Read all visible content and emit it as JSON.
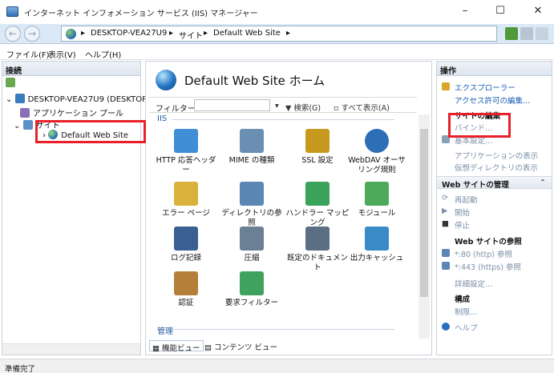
{
  "window": {
    "title": "インターネット インフォメーション サービス (IIS) マネージャー",
    "minimize": "–",
    "maximize": "☐",
    "close": "✕"
  },
  "address": {
    "crumbs": [
      "DESKTOP-VEA27U9",
      "サイト",
      "Default Web Site"
    ],
    "separator": "▸"
  },
  "menu": {
    "items": [
      "ファイル(F)",
      "表示(V)",
      "ヘルプ(H)"
    ]
  },
  "connections": {
    "header": "接続",
    "server": "DESKTOP-VEA27U9 (DESKTOP",
    "app_pools": "アプリケーション プール",
    "sites": "サイト",
    "site": "Default Web Site"
  },
  "center": {
    "title": "Default Web Site ホーム",
    "filter_label": "フィルター:",
    "search": "検索(G)",
    "show_all": "すべて表示(A)",
    "group_iis": "IIS",
    "group_manage": "管理",
    "features": [
      {
        "label": "HTTP 応答ヘッダー",
        "color": "#3f8ed6"
      },
      {
        "label": "MIME の種類",
        "color": "#6a8fb3"
      },
      {
        "label": "SSL 設定",
        "color": "#c79a1f"
      },
      {
        "label": "WebDAV オーサリング規則",
        "color": "#2c6fb6"
      },
      {
        "label": "エラー ページ",
        "color": "#d8b23a"
      },
      {
        "label": "ディレクトリの参照",
        "color": "#5b87b5"
      },
      {
        "label": "ハンドラー マッピング",
        "color": "#3aa35a"
      },
      {
        "label": "モジュール",
        "color": "#4caa5a"
      },
      {
        "label": "ログ記録",
        "color": "#3a5f90"
      },
      {
        "label": "圧縮",
        "color": "#6b7f95"
      },
      {
        "label": "既定のドキュメント",
        "color": "#5b6e83"
      },
      {
        "label": "出力キャッシュ",
        "color": "#3b8ac8"
      },
      {
        "label": "認証",
        "color": "#b57f3a"
      },
      {
        "label": "要求フィルター",
        "color": "#3fa35d"
      }
    ],
    "tab_features": "機能ビュー",
    "tab_content": "コンテンツ ビュー"
  },
  "actions": {
    "header": "操作",
    "explore": "エクスプローラー",
    "edit_permissions": "アクセス許可の編集...",
    "edit_site": "サイトの編集",
    "bindings": "バインド...",
    "basic_settings": "基本設定...",
    "view_apps": "アプリケーションの表示",
    "view_vdirs": "仮想ディレクトリの表示",
    "manage_header": "Web サイトの管理",
    "restart": "再起動",
    "start": "開始",
    "stop": "停止",
    "browse_header": "Web サイトの参照",
    "browse_80": "*:80 (http) 参照",
    "browse_443": "*:443 (https) 参照",
    "advanced": "詳細設定...",
    "config_header": "構成",
    "limits": "制限...",
    "help": "ヘルプ"
  },
  "status": {
    "text": "準備完了"
  }
}
